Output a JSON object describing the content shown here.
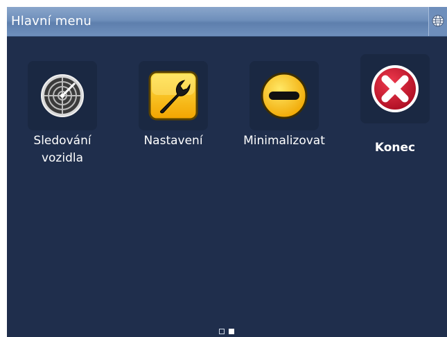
{
  "header": {
    "title": "Hlavní menu",
    "globe_icon": "globe-icon"
  },
  "menu": [
    {
      "label_line1": "Sledování",
      "label_line2": "vozidla",
      "icon": "radar-icon"
    },
    {
      "label": "Nastavení",
      "icon": "wrench-icon"
    },
    {
      "label": "Minimalizovat",
      "icon": "minus-circle-icon"
    },
    {
      "label": "Konec",
      "icon": "close-x-icon"
    }
  ],
  "pager": {
    "pages": 2,
    "current": 2
  },
  "colors": {
    "background": "#1f2e4c",
    "titlebar": "#6f8fbb",
    "accent_yellow": "#f4b400",
    "accent_red": "#c8102e"
  }
}
